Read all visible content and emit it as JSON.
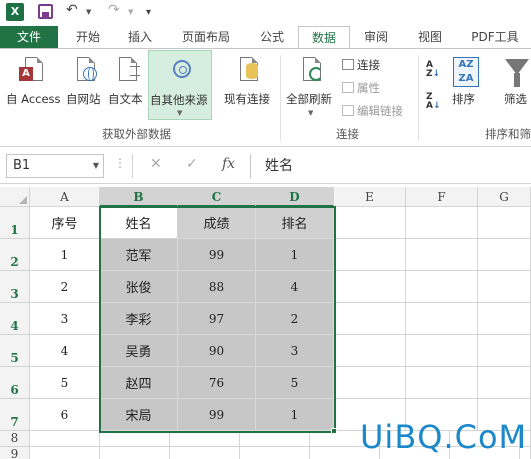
{
  "qat": {
    "app_icon": "X",
    "icons": [
      "save-icon",
      "undo-icon",
      "redo-icon",
      "customize-icon"
    ]
  },
  "tabs": {
    "file": "文件",
    "items": [
      "开始",
      "插入",
      "页面布局",
      "公式",
      "数据",
      "审阅",
      "视图",
      "PDF工具"
    ],
    "active": "数据"
  },
  "ribbon": {
    "get_external": {
      "access": "自 Access",
      "web": "自网站",
      "text": "自文本",
      "other": "自其他来源",
      "existing": "现有连接",
      "group_label": "获取外部数据"
    },
    "connections": {
      "refresh_all": "全部刷新",
      "connections": "连接",
      "properties": "属性",
      "edit_links": "编辑链接",
      "group_label": "连接"
    },
    "sort_filter": {
      "sort": "排序",
      "filter": "筛选",
      "group_label": "排序和筛"
    },
    "accent": "#217346"
  },
  "formula_bar": {
    "name_box": "B1",
    "cancel": "✕",
    "enter": "✓",
    "fx": "fx",
    "content": "姓名"
  },
  "grid": {
    "columns": [
      "A",
      "B",
      "C",
      "D",
      "E",
      "F",
      "G"
    ],
    "rows": [
      "1",
      "2",
      "3",
      "4",
      "5",
      "6",
      "7",
      "8",
      "9"
    ],
    "header": [
      "序号",
      "姓名",
      "成绩",
      "排名"
    ],
    "data": [
      [
        "1",
        "范军",
        "99",
        "1"
      ],
      [
        "2",
        "张俊",
        "88",
        "4"
      ],
      [
        "3",
        "李彩",
        "97",
        "2"
      ],
      [
        "4",
        "吴勇",
        "90",
        "3"
      ],
      [
        "5",
        "赵四",
        "76",
        "5"
      ],
      [
        "6",
        "宋局",
        "99",
        "1"
      ]
    ]
  },
  "watermark": "UiBQ.CoM"
}
